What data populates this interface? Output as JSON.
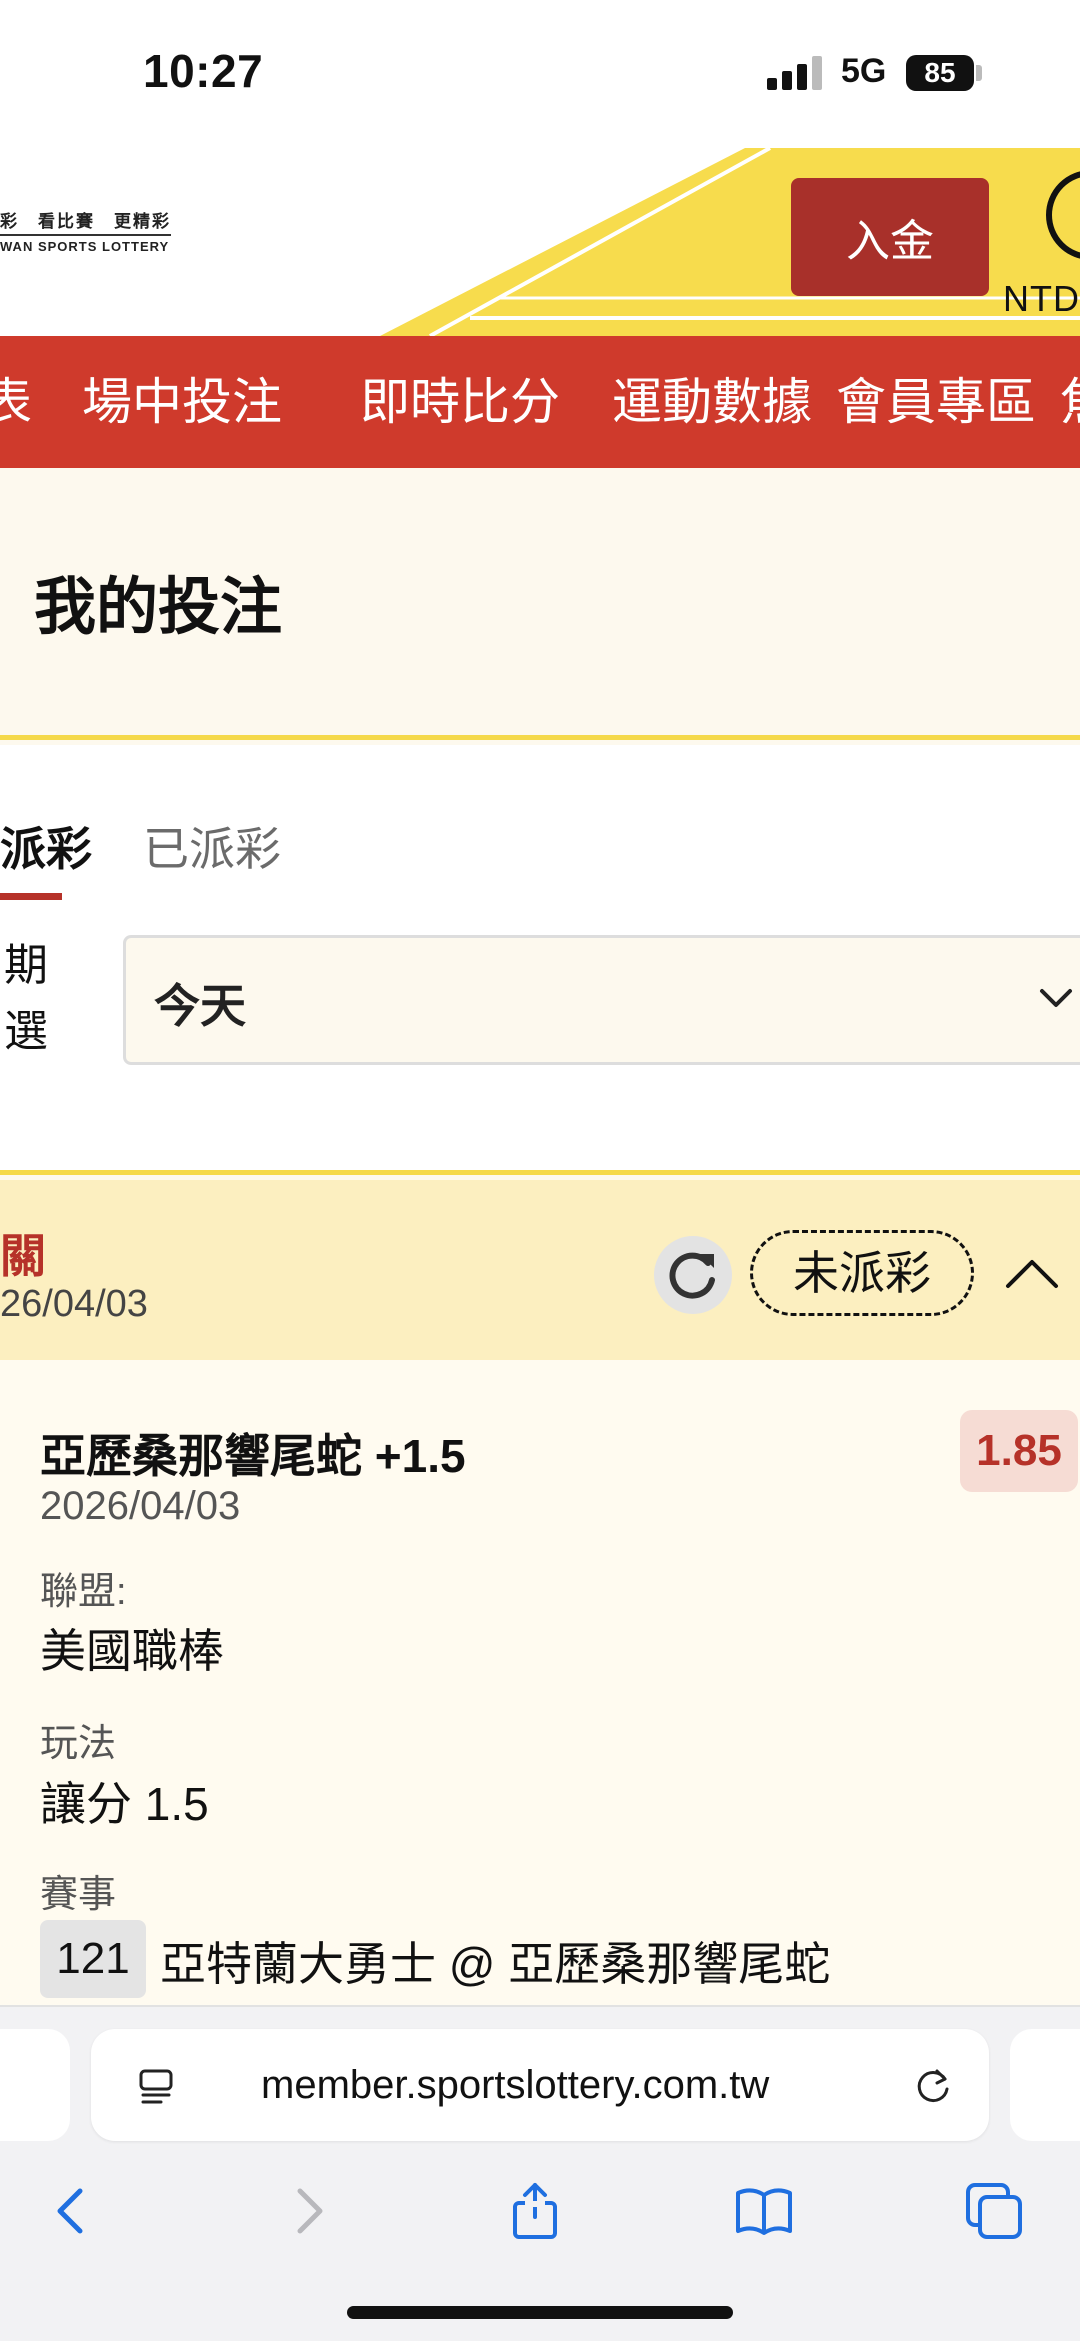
{
  "status_bar": {
    "time": "10:27",
    "network": "5G",
    "battery": "85"
  },
  "header": {
    "logo_line1": "彩　看比賽　更精彩",
    "logo_line2": "WAN SPORTS LOTTERY",
    "deposit_label": "入金",
    "currency": "NTD"
  },
  "nav": {
    "items": [
      {
        "label": "表"
      },
      {
        "label": "場中投注"
      },
      {
        "label": "即時比分"
      },
      {
        "label": "運動數據"
      },
      {
        "label": "會員專區"
      },
      {
        "label": "焦"
      }
    ]
  },
  "page": {
    "title": "我的投注"
  },
  "tabs": {
    "unsettled": "派彩",
    "settled": "已派彩"
  },
  "filter": {
    "label_line1": "期",
    "label_line2": "選",
    "date_value": "今天"
  },
  "bet_group": {
    "type": "關",
    "date": "26/04/03",
    "status": "未派彩"
  },
  "bet": {
    "pick": "亞歷桑那響尾蛇 +1.5",
    "odds": "1.85",
    "date": "2026/04/03",
    "league_label": "聯盟:",
    "league": "美國職棒",
    "market_label": "玩法",
    "market": "讓分 1.5",
    "event_label": "賽事",
    "event_no": "121",
    "event_name": "亞特蘭大勇士 @ 亞歷桑那響尾蛇"
  },
  "browser": {
    "url": "member.sportslottery.com.tw"
  },
  "colors": {
    "brand_red": "#cf3a2c",
    "brand_yellow": "#f5d94a",
    "deep_red": "#a8302a"
  }
}
